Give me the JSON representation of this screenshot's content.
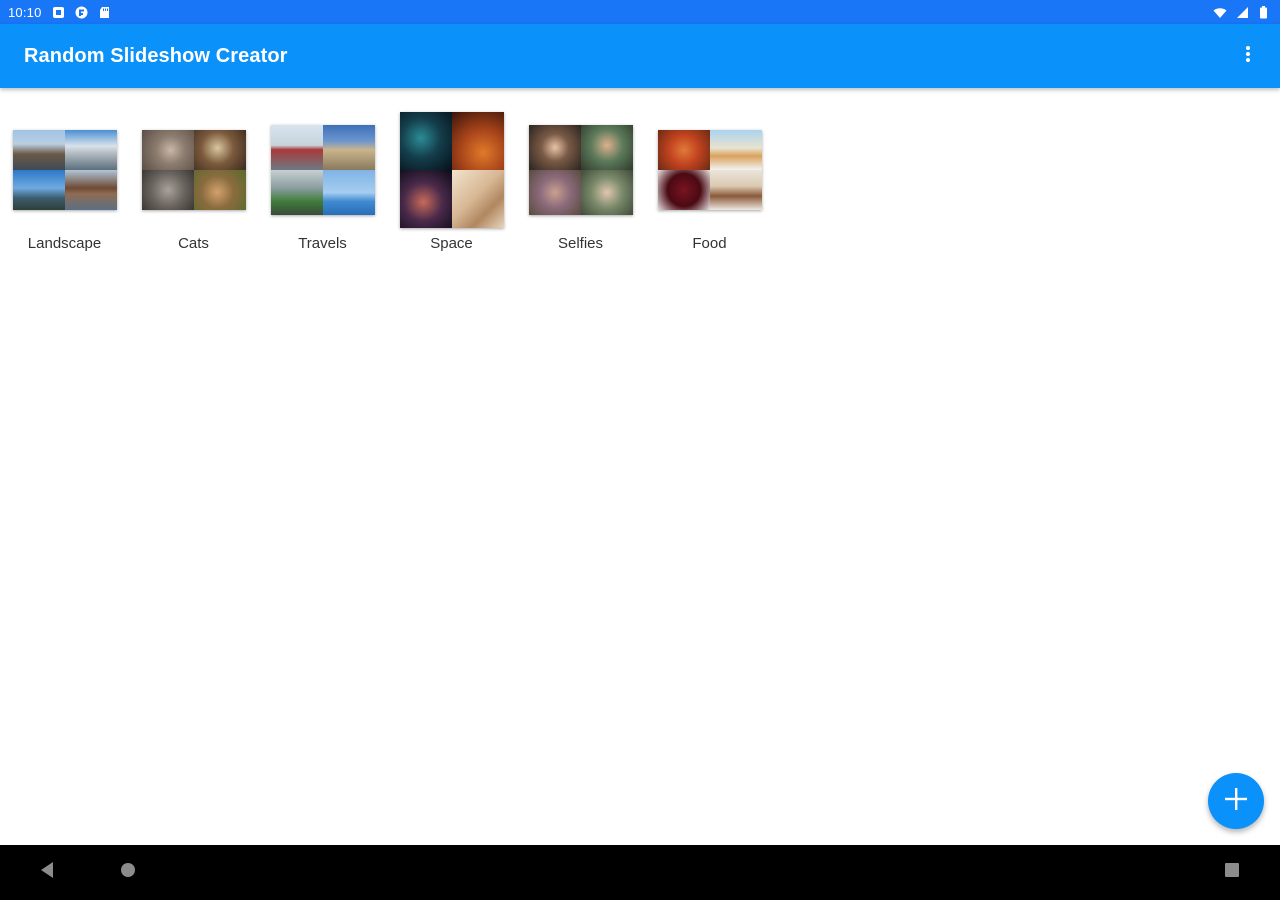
{
  "status_bar": {
    "time": "10:10",
    "notification_icons": [
      "sim-card-icon",
      "flipboard-icon",
      "sd-card-icon"
    ],
    "system_icons": [
      "wifi-icon",
      "signal-icon",
      "battery-icon"
    ]
  },
  "app_bar": {
    "title": "Random Slideshow Creator",
    "overflow_icon": "more-vert-icon"
  },
  "albums": [
    {
      "label": "Landscape"
    },
    {
      "label": "Cats"
    },
    {
      "label": "Travels"
    },
    {
      "label": "Space"
    },
    {
      "label": "Selfies"
    },
    {
      "label": "Food"
    }
  ],
  "fab": {
    "icon": "plus-icon"
  },
  "nav_bar": {
    "icons": [
      "back-icon",
      "home-icon",
      "recents-icon"
    ]
  },
  "colors": {
    "status_bar": "#1976f7",
    "app_bar": "#0a91fa",
    "fab": "#0a91fa",
    "nav_bar": "#000000"
  }
}
